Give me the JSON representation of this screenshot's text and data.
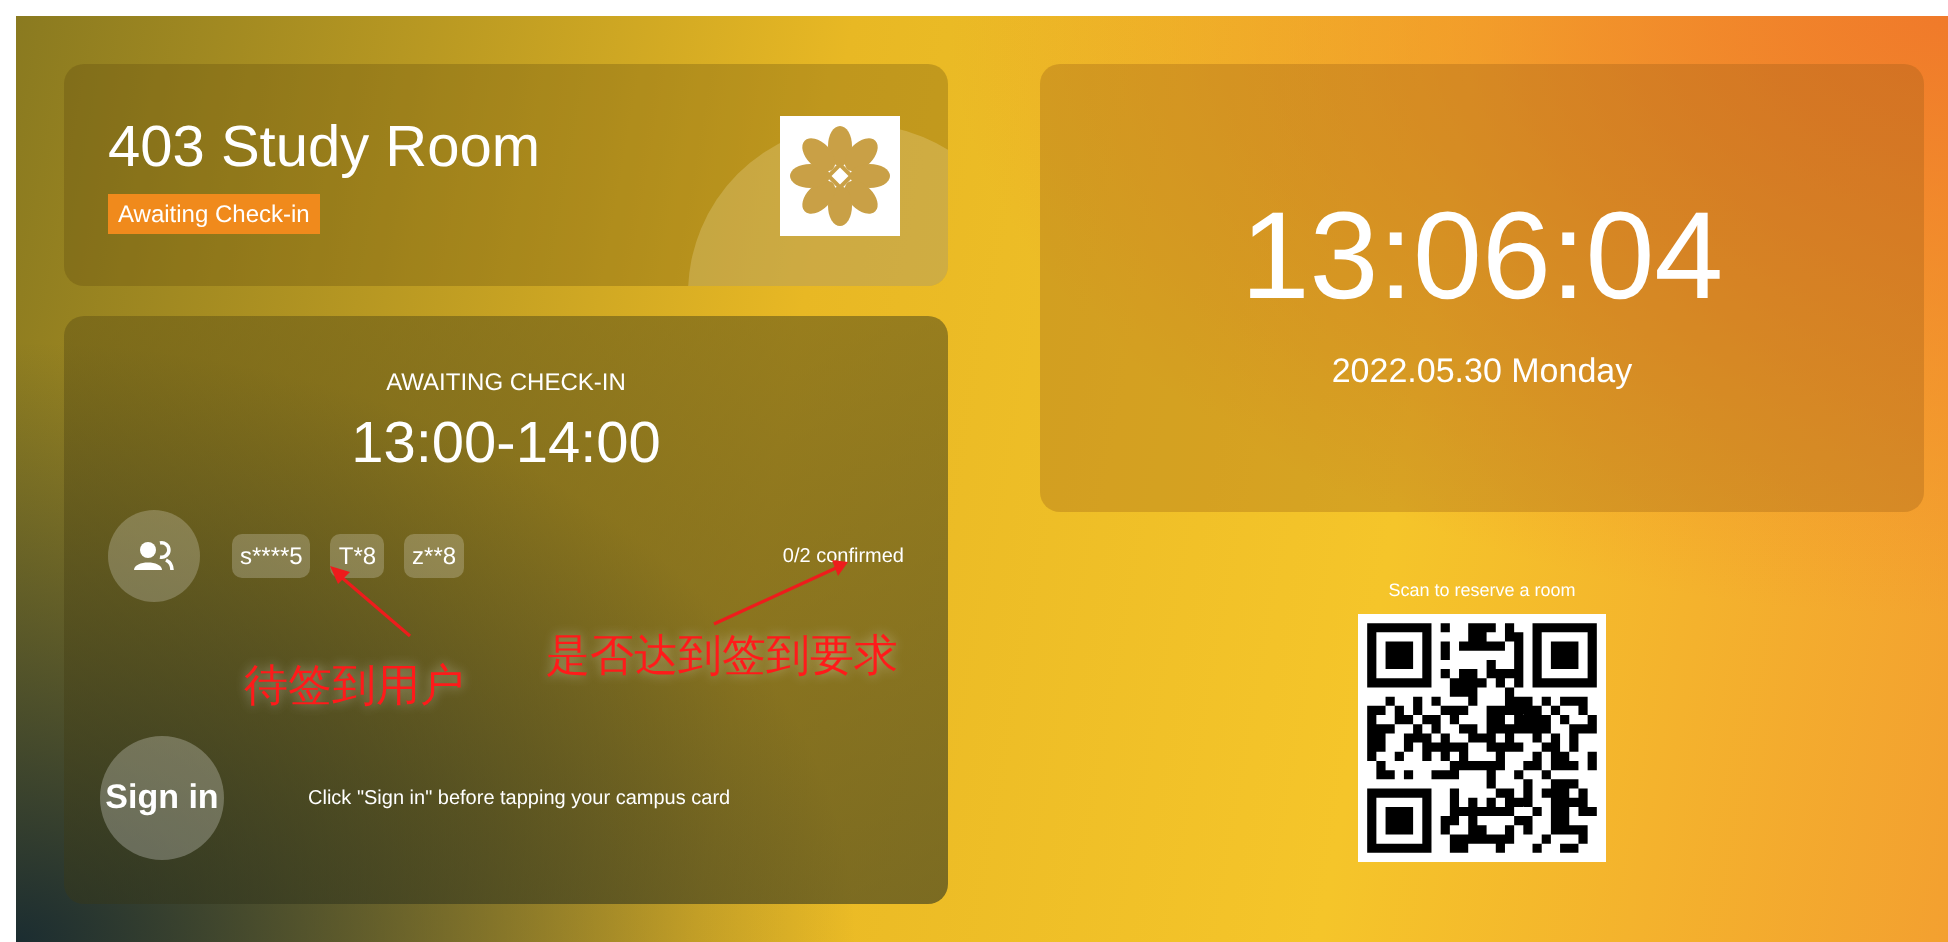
{
  "room": {
    "title": "403 Study Room",
    "status_badge": "Awaiting Check-in"
  },
  "booking": {
    "status": "AWAITING CHECK-IN",
    "time_range": "13:00-14:00",
    "users": [
      "s****5",
      "T*8",
      "z**8"
    ],
    "confirmation": "0/2 confirmed",
    "sign_in_button": "Sign in",
    "hint": "Click \"Sign in\" before tapping your campus card"
  },
  "clock": {
    "time": "13:06:04",
    "date": "2022.05.30 Monday"
  },
  "qr": {
    "caption": "Scan to reserve a room"
  },
  "annotations": [
    {
      "text": "待签到用户"
    },
    {
      "text": "是否达到签到要求"
    }
  ]
}
